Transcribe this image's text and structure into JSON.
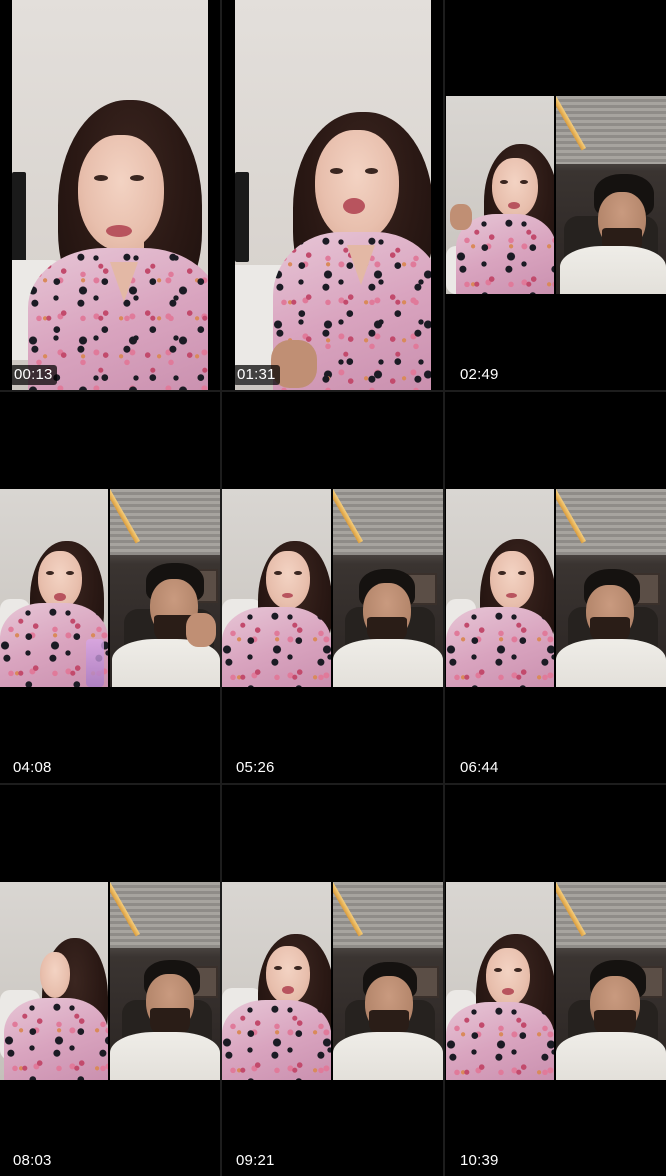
{
  "thumbnails": [
    {
      "time": "00:13",
      "layout": "solo",
      "timestamp_style": "pill"
    },
    {
      "time": "01:31",
      "layout": "solo",
      "timestamp_style": "pill"
    },
    {
      "time": "02:49",
      "layout": "split",
      "timestamp_style": "plain"
    },
    {
      "time": "04:08",
      "layout": "split",
      "timestamp_style": "plain"
    },
    {
      "time": "05:26",
      "layout": "split",
      "timestamp_style": "plain"
    },
    {
      "time": "06:44",
      "layout": "split",
      "timestamp_style": "plain"
    },
    {
      "time": "08:03",
      "layout": "split",
      "timestamp_style": "plain"
    },
    {
      "time": "09:21",
      "layout": "split",
      "timestamp_style": "plain"
    },
    {
      "time": "10:39",
      "layout": "split",
      "timestamp_style": "plain"
    }
  ],
  "colors": {
    "background": "#000000",
    "divider": "#1d1d1d",
    "timestamp_text": "#ffffff"
  }
}
